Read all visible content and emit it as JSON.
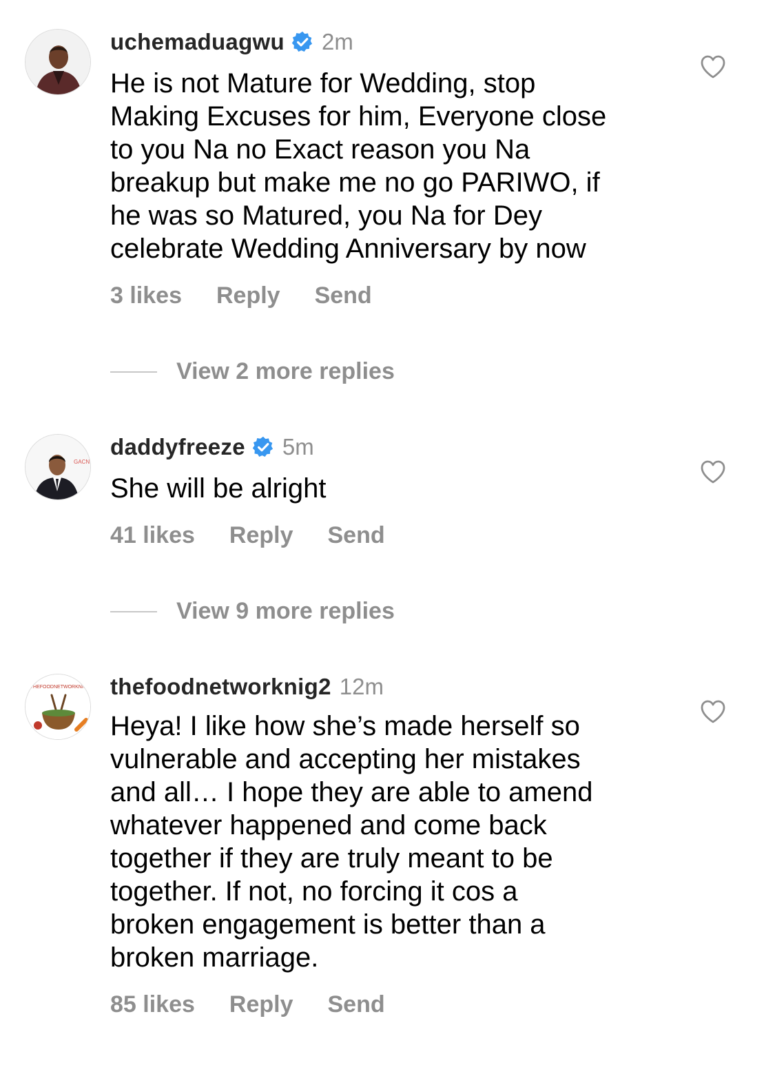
{
  "comments": [
    {
      "username": "uchemaduagwu",
      "verified": true,
      "time": "2m",
      "text": "He is not Mature for Wedding, stop\nMaking Excuses for him, Everyone close\nto you Na no Exact reason you Na\nbreakup but make me no go PARIWO, if\nhe was so Matured, you Na for Dey\ncelebrate Wedding Anniversary by now",
      "likes": "3 likes",
      "reply_label": "Reply",
      "send_label": "Send",
      "view_replies": "View 2 more replies"
    },
    {
      "username": "daddyfreeze",
      "verified": true,
      "time": "5m",
      "text": "She will be alright",
      "likes": "41 likes",
      "reply_label": "Reply",
      "send_label": "Send",
      "view_replies": "View 9 more replies",
      "avatar_text": "GACN"
    },
    {
      "username": "thefoodnetworknig2",
      "verified": false,
      "time": "12m",
      "text": "Heya! I like how she’s made herself so\nvulnerable and accepting her mistakes\nand all… I hope they are able to amend\nwhatever happened and come back\ntogether if they are truly meant to be\ntogether. If not, no forcing it cos a\nbroken engagement is better than a\nbroken marriage.",
      "likes": "85 likes",
      "reply_label": "Reply",
      "send_label": "Send",
      "avatar_text": "THEFOODNETWORKNIG"
    }
  ],
  "icons": {
    "verified": "verified-badge-icon",
    "like": "heart-outline-icon"
  },
  "colors": {
    "verified_blue": "#3897f0",
    "secondary_text": "#8e8e8e",
    "username": "#262626"
  }
}
